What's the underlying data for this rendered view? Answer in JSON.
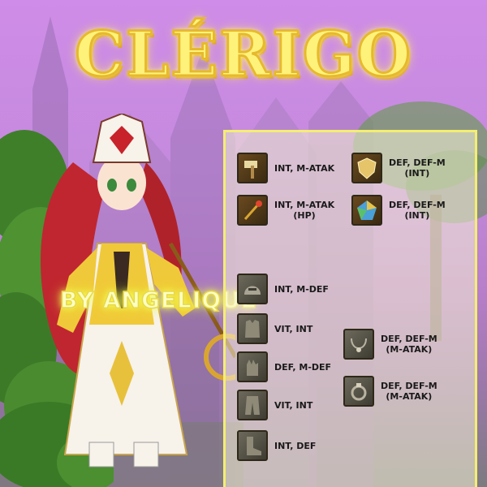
{
  "title": "CLÉRIGO",
  "byline": "BY ANGELIQUE",
  "colors": {
    "title": "#fff27a",
    "panel_border": "#f4ee72",
    "background": "#c48add"
  },
  "items": [
    {
      "icon": "hammer-card-icon",
      "lines": [
        "INT, M-ATAK"
      ]
    },
    {
      "icon": "shield-card-icon",
      "lines": [
        "DEF, DEF-M",
        "(INT)"
      ]
    },
    {
      "icon": "staff-card-icon",
      "lines": [
        "INT, M-ATAK",
        "(HP)"
      ]
    },
    {
      "icon": "gem-card-icon",
      "lines": [
        "DEF, DEF-M",
        "(INT)"
      ]
    },
    {
      "icon": "helmet-icon",
      "lines": [
        "INT, M-DEF"
      ]
    },
    {
      "icon": "armor-icon",
      "lines": [
        "VIT, INT"
      ]
    },
    {
      "icon": "necklace-icon",
      "lines": [
        "DEF, DEF-M",
        "(M-ATAK)"
      ]
    },
    {
      "icon": "gloves-icon",
      "lines": [
        "DEF, M-DEF"
      ]
    },
    {
      "icon": "ring-icon",
      "lines": [
        "DEF, DEF-M",
        "(M-ATAK)"
      ]
    },
    {
      "icon": "pants-icon",
      "lines": [
        "VIT, INT"
      ]
    },
    {
      "icon": "boots-icon",
      "lines": [
        "INT, DEF"
      ]
    }
  ]
}
